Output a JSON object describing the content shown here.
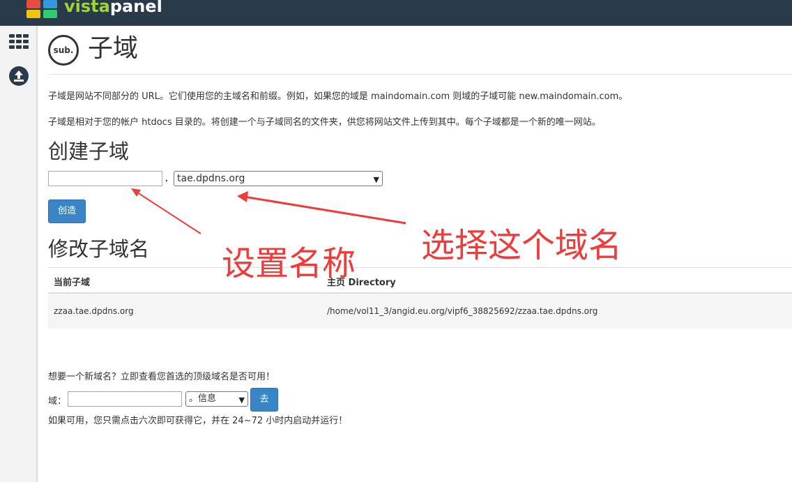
{
  "header": {
    "brand_part1": "vista",
    "brand_part2": "panel"
  },
  "sidebar": {
    "icons": [
      "grid-icon",
      "upload-icon"
    ]
  },
  "page": {
    "badge": "sub.",
    "title": "子域",
    "desc1": "子域是网站不同部分的 URL。它们使用您的主域名和前缀。例如，如果您的域是 maindomain.com 则域的子域可能 new.maindomain.com。",
    "desc2": "子域是相对于您的帐户 htdocs 目录的。将创建一个与子域同名的文件夹，供您将网站文件上传到其中。每个子域都是一个新的唯一网站。"
  },
  "create": {
    "heading": "创建子域",
    "name_value": "",
    "separator": ".",
    "domain_selected": "tae.dpdns.org",
    "button": "创造"
  },
  "modify": {
    "heading": "修改子域名",
    "columns": [
      "当前子域",
      "主页 Directory"
    ],
    "rows": [
      {
        "subdomain": "zzaa.tae.dpdns.org",
        "directory": "/home/vol11_3/angid.eu.org/vipf6_38825692/zzaa.tae.dpdns.org"
      }
    ]
  },
  "promo": {
    "text": "想要一个新域名？立即查看您首选的顶级域名是否可用！",
    "domain_label": "域：",
    "domain_value": "",
    "tld_selected": "。信息",
    "go_button": "去",
    "note": "如果可用，您只需点击六次即可获得它，并在 24~72 小时内启动并运行！"
  },
  "annotations": {
    "set_name": "设置名称",
    "choose_domain": "选择这个域名",
    "color": "#ee3b3b"
  },
  "colors": {
    "topbar": "#293a4a",
    "button": "#3a84c8"
  }
}
